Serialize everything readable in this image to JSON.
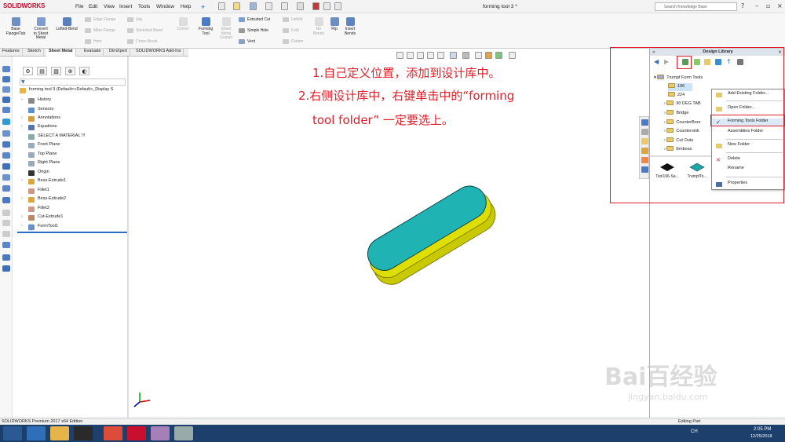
{
  "app": {
    "logo": "SOLIDWORKS",
    "title": "forming tool 3 *",
    "search_placeholder": "Search Knowledge Base"
  },
  "menu": [
    "File",
    "Edit",
    "View",
    "Insert",
    "Tools",
    "Window",
    "Help"
  ],
  "ribbon": {
    "large": [
      {
        "label": "Base\nFlange/Tab",
        "icon": "base-flange-icon",
        "enabled": true
      },
      {
        "label": "Convert\nto Sheet\nMetal",
        "icon": "convert-sheet-metal-icon",
        "enabled": true
      },
      {
        "label": "Lofted-Bend",
        "icon": "lofted-bend-icon",
        "enabled": true
      },
      {
        "label": "Corner",
        "icon": "corner-icon",
        "enabled": false
      },
      {
        "label": "Forming\nTool",
        "icon": "forming-tool-icon",
        "enabled": true
      },
      {
        "label": "Sheet\nMetal\nGusset",
        "icon": "gusset-icon",
        "enabled": false
      },
      {
        "label": "Unfold",
        "icon": "unfold-icon",
        "enabled": false
      },
      {
        "label": "Fold",
        "icon": "fold-icon",
        "enabled": false
      },
      {
        "label": "Flatten",
        "icon": "flatten-icon",
        "enabled": false
      },
      {
        "label": "No\nBends",
        "icon": "no-bends-icon",
        "enabled": false
      },
      {
        "label": "Rip",
        "icon": "rip-icon",
        "enabled": true
      },
      {
        "label": "Insert\nBends",
        "icon": "insert-bends-icon",
        "enabled": true
      }
    ],
    "small": [
      {
        "label": "Edge Flange",
        "enabled": false
      },
      {
        "label": "Miter Flange",
        "enabled": false
      },
      {
        "label": "Hem",
        "enabled": false
      },
      {
        "label": "Jog",
        "enabled": false
      },
      {
        "label": "Sketched Bend",
        "enabled": false
      },
      {
        "label": "Cross-Break",
        "enabled": false
      },
      {
        "label": "Extruded Cut",
        "enabled": true
      },
      {
        "label": "Simple Hole",
        "enabled": true
      },
      {
        "label": "Vent",
        "enabled": true
      }
    ]
  },
  "tabs": [
    {
      "label": "Features",
      "active": false
    },
    {
      "label": "Sketch",
      "active": false
    },
    {
      "label": "Sheet Metal",
      "active": true
    },
    {
      "label": "Evaluate",
      "active": false
    },
    {
      "label": "DimXpert",
      "active": false
    },
    {
      "label": "SOLIDWORKS Add-Ins",
      "active": false
    }
  ],
  "tree": {
    "root": "forming tool 3  (Default<<Default>_Display S",
    "items": [
      {
        "label": "History",
        "icon": "history-icon",
        "expandable": true
      },
      {
        "label": "Sensors",
        "icon": "sensors-icon",
        "expandable": false
      },
      {
        "label": "Annotations",
        "icon": "annotations-icon",
        "expandable": true
      },
      {
        "label": "Equations",
        "icon": "equations-icon",
        "expandable": true
      },
      {
        "label": "SELECT A MATERIAL !!!",
        "icon": "material-icon",
        "expandable": false
      },
      {
        "label": "Front Plane",
        "icon": "plane-icon",
        "expandable": false
      },
      {
        "label": "Top Plane",
        "icon": "plane-icon",
        "expandable": false
      },
      {
        "label": "Right Plane",
        "icon": "plane-icon",
        "expandable": false
      },
      {
        "label": "Origin",
        "icon": "origin-icon",
        "expandable": false
      },
      {
        "label": "Boss-Extrude1",
        "icon": "boss-extrude-icon",
        "expandable": true
      },
      {
        "label": "Fillet1",
        "icon": "fillet-icon",
        "expandable": false
      },
      {
        "label": "Boss-Extrude2",
        "icon": "boss-extrude-icon",
        "expandable": true
      },
      {
        "label": "Fillet3",
        "icon": "fillet-icon",
        "expandable": false
      },
      {
        "label": "Cut-Extrude1",
        "icon": "cut-extrude-icon",
        "expandable": true
      },
      {
        "label": "FormTool1",
        "icon": "form-tool-icon",
        "expandable": true
      }
    ]
  },
  "annotation": {
    "line1": "1.自己定义位置，添加到设计库中。",
    "line2": "2.右侧设计库中，右键单击中的“forming",
    "line3": "tool folder”  一定要选上。"
  },
  "design_library": {
    "title": "Design Library",
    "root": "Trumpf Form Tools",
    "folders": [
      "196",
      "224",
      "90 DEG TAB",
      "Bridge",
      "CounterBore",
      "Countersink",
      "Cut Outs",
      "Emboss"
    ],
    "thumbnails": [
      "Tool196-Sa...",
      "TrumpfTo..."
    ]
  },
  "context_menu": [
    {
      "label": "Add Existing Folder...",
      "icon": "add-folder-icon",
      "checked": false
    },
    {
      "label": "Open Folder...",
      "icon": "open-folder-icon",
      "checked": false
    },
    {
      "label": "Forming Tools Folder",
      "icon": "check-icon",
      "checked": true
    },
    {
      "label": "Assemblies Folder",
      "icon": "",
      "checked": false
    },
    {
      "label": "New Folder",
      "icon": "new-folder-icon",
      "checked": false
    },
    {
      "label": "Delete",
      "icon": "delete-icon",
      "checked": false
    },
    {
      "label": "Rename",
      "icon": "",
      "checked": false
    },
    {
      "label": "Properties",
      "icon": "properties-icon",
      "checked": false
    }
  ],
  "status": {
    "left": "SOLIDWORKS Premium 2017 x64 Edition",
    "right": "Editing Part"
  },
  "taskbar": {
    "lang": "CH",
    "time": "2:05 PM",
    "date": "12/25/2018"
  },
  "watermark": {
    "brand": "Bai百经验",
    "url": "jingyan.baidu.com"
  },
  "colors": {
    "model_top": "#1fb3b3",
    "model_side": "#d8d800",
    "annotation_red": "#e0202a"
  }
}
